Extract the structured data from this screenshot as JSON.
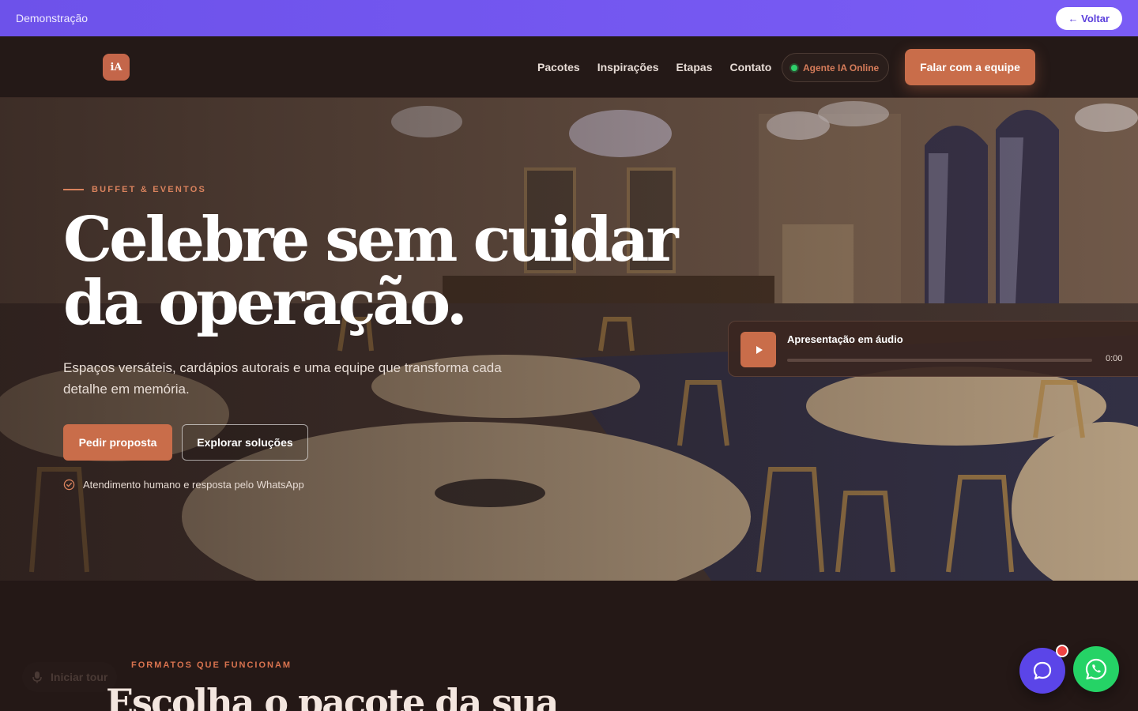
{
  "demo_bar": {
    "label": "Demonstração",
    "back_label": "← Voltar"
  },
  "header": {
    "logo_text": "iA",
    "nav": [
      "Pacotes",
      "Inspirações",
      "Etapas",
      "Contato"
    ],
    "agent_status": "Agente IA Online",
    "cta_label": "Falar com a equipe"
  },
  "hero": {
    "eyebrow": "BUFFET & EVENTOS",
    "title_line1": "Celebre sem cuidar",
    "title_line2": "da operação.",
    "subtitle": "Espaços versáteis, cardápios autorais e uma equipe que transforma cada detalhe em memória.",
    "primary_button": "Pedir proposta",
    "secondary_button": "Explorar soluções",
    "assurance": "Atendimento humano e resposta pelo WhatsApp"
  },
  "audio_player": {
    "title": "Apresentação em áudio",
    "time": "0:00",
    "progress": 0
  },
  "section": {
    "eyebrow": "FORMATOS QUE FUNCIONAM",
    "title": "Escolha o pacote da sua"
  },
  "tour": {
    "label": "Iniciar tour"
  },
  "colors": {
    "accent": "#c96d4a",
    "demo_bar": "#6d52ea",
    "background": "#241816",
    "online": "#2fd06b",
    "whatsapp": "#25d366",
    "chat": "#5b45e8"
  }
}
